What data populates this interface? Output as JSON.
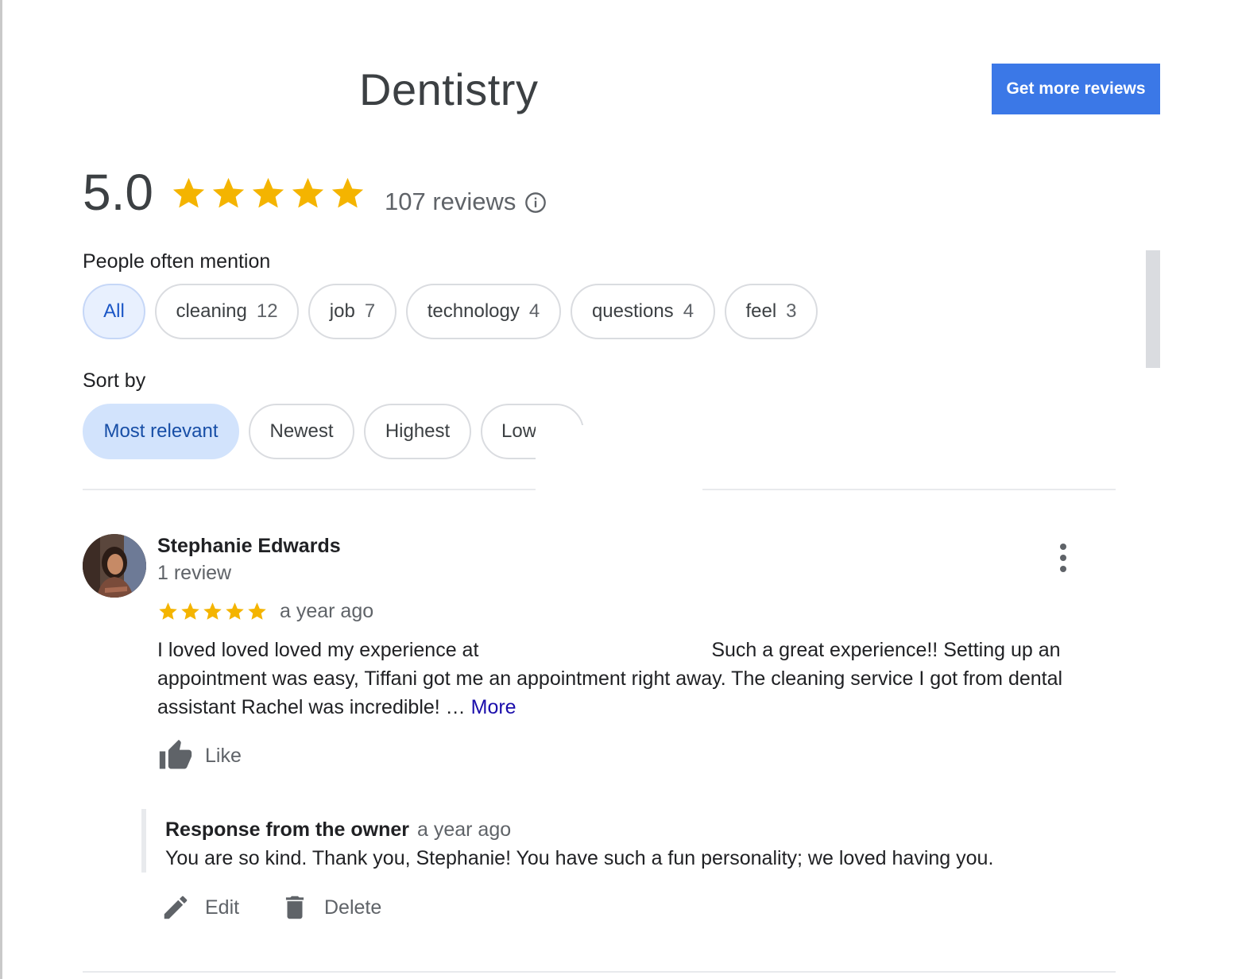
{
  "header": {
    "title": "Dentistry",
    "get_more_reviews": "Get more reviews"
  },
  "summary": {
    "rating": "5.0",
    "stars": 5,
    "review_count": "107 reviews",
    "star_color": "#f4b400"
  },
  "mentions": {
    "label": "People often mention",
    "chips": [
      {
        "label": "All",
        "count": ""
      },
      {
        "label": "cleaning",
        "count": "12"
      },
      {
        "label": "job",
        "count": "7"
      },
      {
        "label": "technology",
        "count": "4"
      },
      {
        "label": "questions",
        "count": "4"
      },
      {
        "label": "feel",
        "count": "3"
      }
    ]
  },
  "sort": {
    "label": "Sort by",
    "options": [
      "Most relevant",
      "Newest",
      "Highest",
      "Low"
    ]
  },
  "review": {
    "name": "Stephanie Edwards",
    "meta": "1 review",
    "stars": 5,
    "date": "a year ago",
    "text_before": "I loved loved loved my experience at ",
    "text_after": "Such a great experience!! Setting up an appointment was easy, Tiffani got me an appointment right away. The cleaning service I got from dental assistant Rachel was incredible! … ",
    "more": "More",
    "like": "Like",
    "response": {
      "label": "Response from the owner",
      "date": "a year ago",
      "text": "You are so kind. Thank you, Stephanie! You have such a fun personality; we loved having you."
    },
    "edit": "Edit",
    "delete": "Delete"
  },
  "colors": {
    "primary_button": "#3b78e7",
    "link": "#1a0dab",
    "selected_chip": "#d2e3fc"
  }
}
